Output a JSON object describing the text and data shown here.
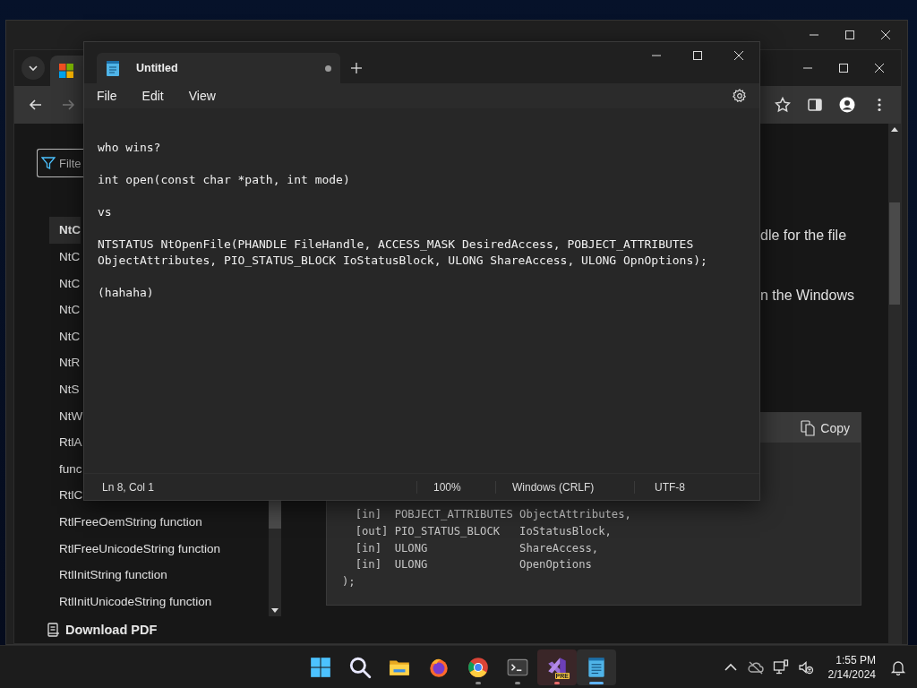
{
  "browser_window": {
    "tabs": [
      {
        "selected": true
      }
    ],
    "toolbar": {
      "back_disabled": false,
      "forward_disabled": true
    },
    "nav": {
      "filter_placeholder": "Filte",
      "download_label": "Download PDF",
      "items": [
        {
          "label": "NtC",
          "selected": true
        },
        {
          "label": "NtC",
          "selected": false
        },
        {
          "label": "NtC",
          "selected": false
        },
        {
          "label": "NtC",
          "selected": false
        },
        {
          "label": "NtC",
          "selected": false
        },
        {
          "label": "NtR",
          "selected": false
        },
        {
          "label": "NtS",
          "selected": false
        },
        {
          "label": "NtW",
          "selected": false
        },
        {
          "label": "RtlA",
          "selected": false
        },
        {
          "label": "func",
          "selected": false
        },
        {
          "label": "RtlC",
          "selected": false
        },
        {
          "label": "RtlFreeOemString function",
          "selected": false
        },
        {
          "label": "RtlFreeUnicodeString function",
          "selected": false
        },
        {
          "label": "RtlInitString function",
          "selected": false
        },
        {
          "label": "RtlInitUnicodeString function",
          "selected": false
        }
      ]
    },
    "article": {
      "paragraphs": [
        "dle for the file",
        "n the Windows"
      ],
      "code": {
        "copy_label": "Copy",
        "lines": [
          "  [in]  POBJECT_ATTRIBUTES ObjectAttributes,",
          "  [out] PIO_STATUS_BLOCK   IoStatusBlock,",
          "  [in]  ULONG              ShareAccess,",
          "  [in]  ULONG              OpenOptions",
          ");"
        ]
      }
    }
  },
  "notepad": {
    "tab": {
      "title": "Untitled",
      "unsaved": true
    },
    "menu": [
      "File",
      "Edit",
      "View"
    ],
    "lines": [
      "who wins?",
      "int open(const char *path, int mode)",
      "vs",
      "NTSTATUS NtOpenFile(PHANDLE FileHandle, ACCESS_MASK DesiredAccess, POBJECT_ATTRIBUTES ObjectAttributes, PIO_STATUS_BLOCK IoStatusBlock, ULONG ShareAccess, ULONG OpnOptions);",
      "(hahaha)"
    ],
    "status": [
      "Ln 8, Col 1",
      "100%",
      "Windows (CRLF)",
      "UTF-8"
    ]
  },
  "taskbar": {
    "apps": [
      {
        "kind": "start",
        "running": false,
        "active": false
      },
      {
        "kind": "search",
        "running": false,
        "active": false
      },
      {
        "kind": "folder",
        "running": false,
        "active": false
      },
      {
        "kind": "firefox",
        "running": false,
        "active": false
      },
      {
        "kind": "chrome",
        "running": true,
        "active": false
      },
      {
        "kind": "terminal",
        "running": true,
        "active": false
      },
      {
        "kind": "studio",
        "running": true,
        "active": false,
        "attention": true,
        "badge": "PRE"
      },
      {
        "kind": "notepad",
        "running": true,
        "active": true
      }
    ],
    "time": "1:55 PM",
    "date": "2/14/2024"
  }
}
